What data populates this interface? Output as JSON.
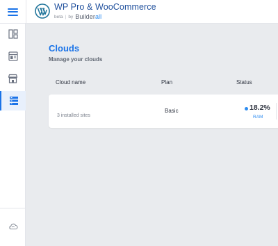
{
  "header": {
    "title": "WP Pro & WooCommerce",
    "beta": "beta",
    "by": "by",
    "brand_main": "Builder",
    "brand_accent": "all"
  },
  "sidebar": {
    "items": [
      {
        "icon": "layout-icon",
        "active": false
      },
      {
        "icon": "browser-window-icon",
        "active": false
      },
      {
        "icon": "store-icon",
        "active": false
      },
      {
        "icon": "server-stack-icon",
        "active": true
      }
    ],
    "bottom_icon": "cloud-sync-icon"
  },
  "page": {
    "title": "Clouds",
    "subtitle": "Manage your clouds"
  },
  "table": {
    "headers": {
      "cloud_name": "Cloud name",
      "plan": "Plan",
      "status": "Status"
    },
    "rows": [
      {
        "installed": "3 installed sites",
        "plan": "Basic",
        "status_value": "18.2%",
        "status_label": "RAM"
      }
    ]
  },
  "colors": {
    "accent": "#1a73e8",
    "status_dot": "#2d8cf0",
    "background": "#e9ebee"
  }
}
